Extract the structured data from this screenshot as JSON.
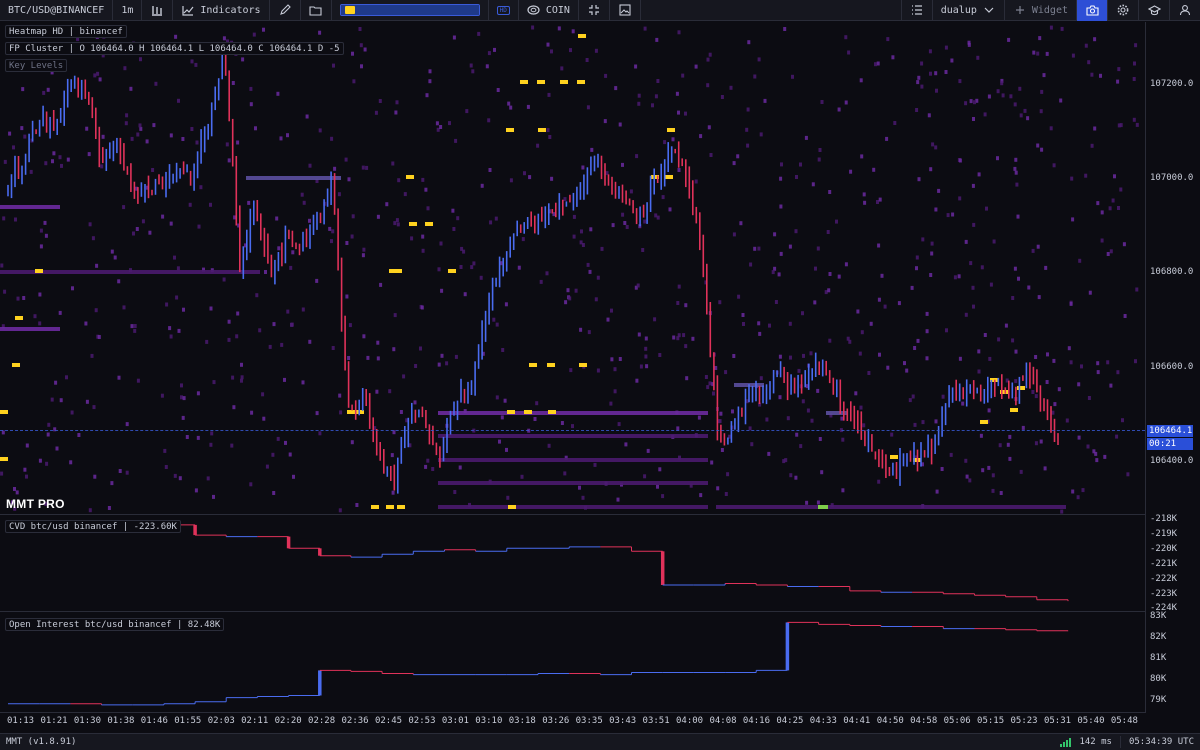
{
  "toolbar": {
    "symbol": "BTC/USD@BINANCEF",
    "timeframe": "1m",
    "indicators_label": "Indicators",
    "hd_badge": "HD",
    "coin_label": "COIN",
    "layout_name": "dualup",
    "widget_label": "Widget",
    "icons": [
      "chart-type-icon",
      "indicators-icon",
      "pen-icon",
      "folder-icon",
      "hd-icon",
      "coin-icon",
      "compress-icon",
      "image-icon",
      "list-icon",
      "chevron-down-icon",
      "plus-icon",
      "camera-icon",
      "gear-icon",
      "academy-icon",
      "user-icon"
    ],
    "accent": "#2e4fd6"
  },
  "panes": {
    "heatmap_label": "Heatmap HD | binancef",
    "fp_cluster_label": "FP Cluster | O 106464.0 H 106464.1 L 106464.0 C 106464.1 D -5",
    "key_levels_label": "Key Levels",
    "watermark": "MMT PRO",
    "cvd_label": "CVD btc/usd binancef | -223.60K",
    "oi_label": "Open Interest btc/usd binancef | 82.48K"
  },
  "price_axis": {
    "ticks": [
      "107200.0",
      "107000.0",
      "106800.0",
      "106600.0",
      "106400.0"
    ],
    "current_price": "106464.1",
    "countdown": "00:21"
  },
  "cvd_axis": {
    "ticks": [
      "-218K",
      "-219K",
      "-220K",
      "-221K",
      "-222K",
      "-223K",
      "-224K"
    ]
  },
  "oi_axis": {
    "ticks": [
      "83K",
      "82K",
      "81K",
      "80K",
      "79K"
    ]
  },
  "time_axis": {
    "ticks": [
      "01:13",
      "01:21",
      "01:30",
      "01:38",
      "01:46",
      "01:55",
      "02:03",
      "02:11",
      "02:20",
      "02:28",
      "02:36",
      "02:45",
      "02:53",
      "03:01",
      "03:10",
      "03:18",
      "03:26",
      "03:35",
      "03:43",
      "03:51",
      "04:00",
      "04:08",
      "04:16",
      "04:25",
      "04:33",
      "04:41",
      "04:50",
      "04:58",
      "05:06",
      "05:15",
      "05:23",
      "05:31",
      "05:40",
      "05:48"
    ]
  },
  "status": {
    "version": "MMT (v1.8.91)",
    "latency": "142 ms",
    "clock": "05:34:39 UTC"
  },
  "colors": {
    "up": "#4a6cf0",
    "down": "#e0325a",
    "heat_low": "#4a1a6e",
    "heat_mid": "#6b2aa0",
    "heat_high": "#ffd21f",
    "heat_green": "#7fcf4a"
  },
  "chart_data": [
    {
      "type": "candlestick",
      "title": "FP Cluster",
      "ylabel": "",
      "ylim": [
        106320,
        107330
      ],
      "x_ticks": [
        "01:13",
        "01:21",
        "01:30",
        "01:38",
        "01:46",
        "01:55",
        "02:03",
        "02:11",
        "02:20",
        "02:28",
        "02:36",
        "02:45",
        "02:53",
        "03:01",
        "03:10",
        "03:18",
        "03:26",
        "03:35",
        "03:43",
        "03:51",
        "04:00",
        "04:08",
        "04:16",
        "04:25",
        "04:33",
        "04:41",
        "04:50",
        "04:58",
        "05:06",
        "05:15",
        "05:23",
        "05:31"
      ],
      "close_path": [
        106990,
        107050,
        107130,
        107110,
        107210,
        107180,
        107050,
        107080,
        107000,
        106980,
        107000,
        107030,
        107010,
        107130,
        107280,
        106820,
        106960,
        106820,
        106880,
        106870,
        106930,
        107000,
        106530,
        106560,
        106440,
        106380,
        106520,
        106510,
        106440,
        106560,
        106570,
        106740,
        106840,
        106900,
        106920,
        106930,
        106960,
        106980,
        107060,
        106990,
        106960,
        106940,
        107010,
        107060,
        107010,
        106820,
        106470,
        106490,
        106570,
        106560,
        106610,
        106560,
        106620,
        106610,
        106530,
        106510,
        106440,
        106400,
        106420,
        106440,
        106460,
        106560,
        106570,
        106580,
        106590,
        106560,
        106610,
        106540,
        106464
      ],
      "last": 106464.1
    },
    {
      "type": "line",
      "title": "CVD btc/usd binancef",
      "ylim": [
        -224,
        -218
      ],
      "units": "K",
      "values": [
        -218.4,
        -218.4,
        -218.5,
        -218.5,
        -218.4,
        -218.4,
        -219.1,
        -219.2,
        -219.2,
        -220.0,
        -220.5,
        -220.6,
        -220.4,
        -220.2,
        -220.1,
        -220.2,
        -220.0,
        -220.0,
        -219.9,
        -219.9,
        -220.2,
        -222.5,
        -222.5,
        -222.4,
        -222.5,
        -222.6,
        -222.6,
        -222.9,
        -223.0,
        -223.0,
        -223.1,
        -223.2,
        -223.3,
        -223.5,
        -223.6
      ],
      "last": -223.6
    },
    {
      "type": "line",
      "title": "Open Interest btc/usd binancef",
      "ylim": [
        78.8,
        83.3
      ],
      "units": "K",
      "values": [
        79.0,
        79.0,
        79.0,
        78.95,
        78.95,
        79.0,
        79.1,
        79.3,
        79.35,
        79.4,
        80.6,
        80.55,
        80.45,
        80.4,
        80.4,
        80.4,
        80.4,
        80.45,
        80.45,
        80.4,
        80.5,
        80.5,
        80.5,
        80.5,
        80.6,
        82.9,
        82.8,
        82.75,
        82.7,
        82.7,
        82.6,
        82.6,
        82.55,
        82.5,
        82.48
      ],
      "last": 82.48
    }
  ]
}
